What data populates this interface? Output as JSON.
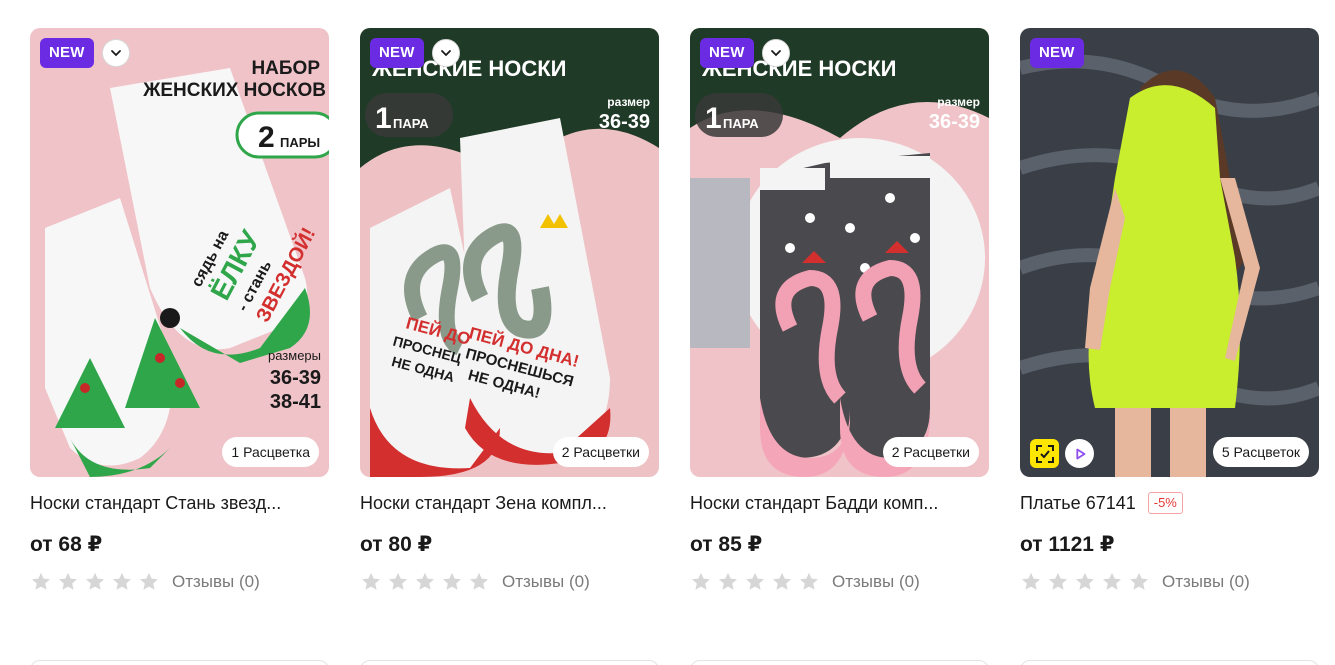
{
  "products": [
    {
      "badge": "NEW",
      "art": {
        "bg": "#efc3c8",
        "headline_1": "НАБОР",
        "headline_2": "ЖЕНСКИХ НОСКОВ",
        "count_num": "2",
        "count_word": "ПАРЫ",
        "sizes_label": "размеры",
        "sizes": [
          "36-39",
          "38-41"
        ],
        "print_lines": [
          "сядь на",
          "ЁЛКУ",
          "- стань",
          "ЗВЕЗДОЙ!"
        ]
      },
      "colors_label": "1 Расцветка",
      "title": "Носки стандарт Стань звезд...",
      "price": "от 68 ₽",
      "reviews": "Отзывы (0)",
      "rating": 0
    },
    {
      "badge": "NEW",
      "art": {
        "bg": "#eec2c5",
        "headline": "ЖЕНСКИЕ НОСКИ",
        "count_num": "1",
        "count_word": "ПАРА",
        "size_label": "размер",
        "size": "36-39",
        "print_lines": [
          "ПЕЙ ДО ДНА!",
          "ПРОСНЕШЬСЯ",
          "НЕ ОДНА!"
        ],
        "print_left": [
          "ПЕЙ ДО",
          "ПРОСНЕЦ",
          "НЕ ОДНА"
        ]
      },
      "colors_label": "2 Расцветки",
      "title": "Носки стандарт Зена компл...",
      "price": "от 80 ₽",
      "reviews": "Отзывы (0)",
      "rating": 0
    },
    {
      "badge": "NEW",
      "art": {
        "bg": "#efc3c8",
        "headline": "ЖЕНСКИЕ НОСКИ",
        "count_num": "1",
        "count_word": "ПАРА",
        "size_label": "размер",
        "size": "36-39"
      },
      "colors_label": "2 Расцветки",
      "title": "Носки стандарт Бадди комп...",
      "price": "от 85 ₽",
      "reviews": "Отзывы (0)",
      "rating": 0
    },
    {
      "badge": "NEW",
      "art": {
        "bg": "#3a3f47",
        "dress": "#c8ee2e"
      },
      "colors_label": "5 Расцветок",
      "title": "Платье 67141",
      "discount": "-5%",
      "price": "от 1121 ₽",
      "reviews": "Отзывы (0)",
      "rating": 0
    }
  ],
  "colors": {
    "badge": "#6b2be3",
    "star_empty": "#d6d6d6",
    "discount": "#e53935",
    "fit_icon": "#ffe600",
    "play_icon": "#8e4ef0"
  },
  "icons": {
    "chevron": "chevron-down-icon",
    "fit": "size-fit-icon",
    "play": "play-video-icon",
    "star": "star-icon"
  }
}
